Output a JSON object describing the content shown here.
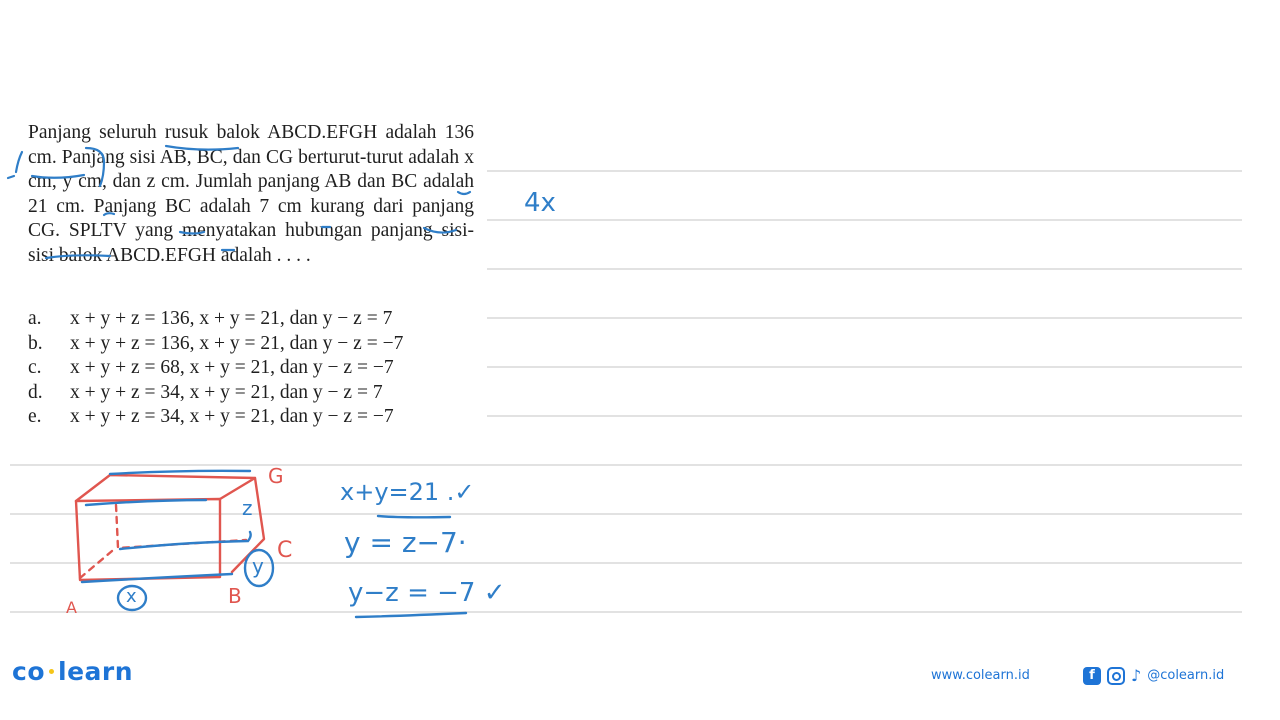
{
  "question": {
    "text": "Panjang seluruh rusuk balok ABCD.EFGH adalah 136 cm. Panjang sisi AB, BC, dan CG berturut-turut adalah x cm, y cm, dan z cm. Jumlah panjang AB dan BC adalah 21 cm. Panjang BC adalah 7 cm kurang dari panjang CG. SPLTV yang menyatakan hubungan panjang sisi-sisi balok ABCD.EFGH adalah . . . ."
  },
  "options": [
    {
      "label": "a.",
      "text": "x + y + z = 136, x + y = 21, dan y − z = 7"
    },
    {
      "label": "b.",
      "text": "x + y + z = 136, x + y = 21, dan y − z = −7"
    },
    {
      "label": "c.",
      "text": "x + y + z = 68, x + y = 21, dan y − z = −7"
    },
    {
      "label": "d.",
      "text": "x + y + z = 34, x + y = 21, dan y − z = 7"
    },
    {
      "label": "e.",
      "text": "x + y + z = 34, x + y = 21, dan y − z = −7"
    }
  ],
  "handwriting": {
    "note_top": "4x",
    "eq1": "x+y=21 .✓",
    "eq2": "y = z−7·",
    "eq3": "y−z = −7 ✓",
    "diagram_labels": {
      "G": "G",
      "z": "z",
      "C": "C",
      "y": "y",
      "B": "B",
      "x": "x",
      "A": "A"
    }
  },
  "colors": {
    "brand": "#1e74d6",
    "ink_blue": "#2f7ec8",
    "ink_red": "#e0564f",
    "rule": "#e2e2e2"
  },
  "footer": {
    "logo_left": "co",
    "logo_right": "learn",
    "url": "www.colearn.id",
    "handle": "@colearn.id",
    "facebook_glyph": "f",
    "tiktok_glyph": "♪"
  }
}
